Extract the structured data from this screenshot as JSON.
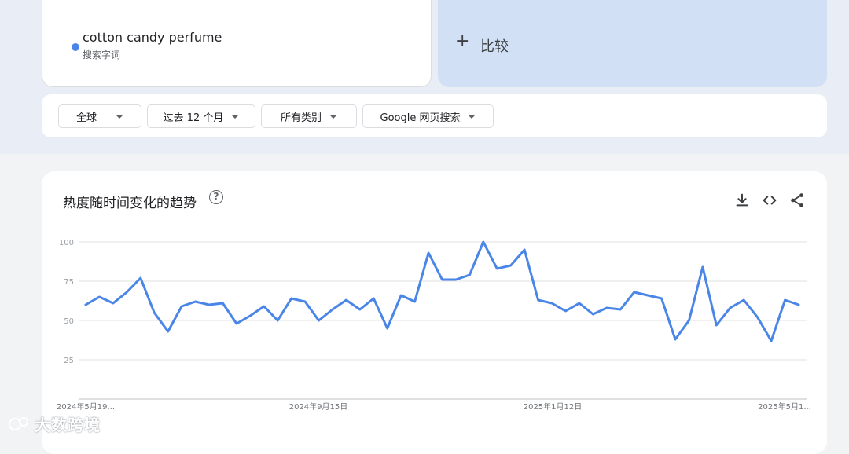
{
  "search_term": {
    "title": "cotton candy perfume",
    "subtitle": "搜索字词",
    "color": "#4a86e8"
  },
  "compare": {
    "label": "比较"
  },
  "filters": {
    "region": "全球",
    "period": "过去 12 个月",
    "category": "所有类别",
    "source": "Google 网页搜索"
  },
  "chart_card": {
    "title": "热度随时间变化的趋势",
    "icons": [
      "help-icon",
      "download-icon",
      "embed-icon",
      "share-icon"
    ]
  },
  "watermark": {
    "text": "大数跨境"
  },
  "chart_data": {
    "type": "line",
    "title": "热度随时间变化的趋势",
    "xlabel": "",
    "ylabel": "",
    "ylim": [
      0,
      100
    ],
    "yticks": [
      25,
      50,
      75,
      100
    ],
    "xtick_labels": [
      "2024年5月19...",
      "2024年9月15日",
      "2025年1月12日",
      "2025年5月1..."
    ],
    "grid": true,
    "series": [
      {
        "color": "#4a86e8",
        "values": [
          60,
          65,
          61,
          68,
          77,
          55,
          43,
          59,
          62,
          60,
          61,
          48,
          53,
          59,
          50,
          64,
          62,
          50,
          57,
          63,
          57,
          64,
          45,
          66,
          62,
          93,
          76,
          76,
          79,
          100,
          83,
          85,
          95,
          63,
          61,
          56,
          61,
          54,
          58,
          57,
          68,
          66,
          64,
          38,
          50,
          84,
          47,
          58,
          63,
          52,
          37,
          63,
          60
        ]
      }
    ]
  }
}
